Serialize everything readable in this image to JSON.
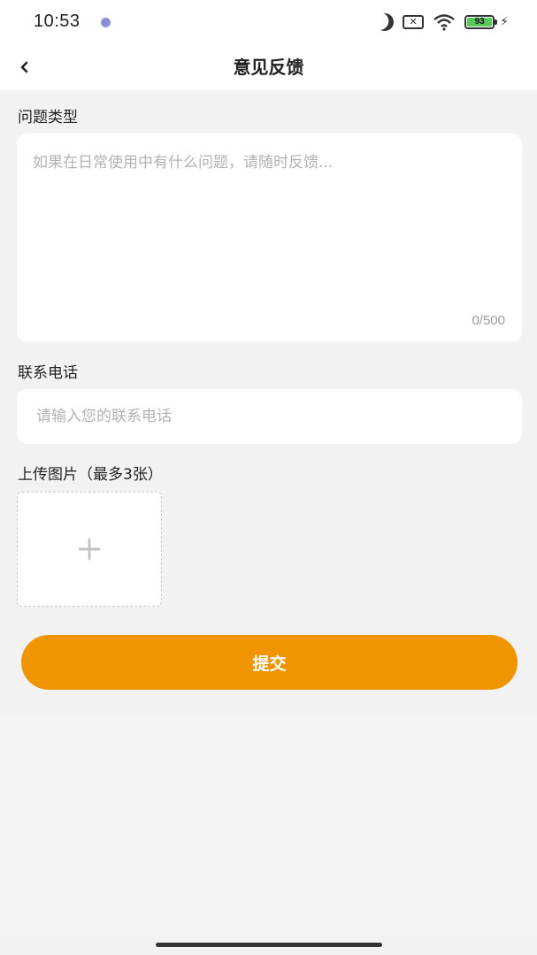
{
  "status_bar": {
    "time": "10:53",
    "battery": "93"
  },
  "nav": {
    "title": "意见反馈"
  },
  "form": {
    "issue_type_label": "问题类型",
    "issue_placeholder": "如果在日常使用中有什么问题，请随时反馈...",
    "char_count": "0/500",
    "phone_label": "联系电话",
    "phone_placeholder": "请输入您的联系电话",
    "upload_label": "上传图片（最多3张）",
    "submit_label": "提交"
  },
  "colors": {
    "accent": "#f09400",
    "background": "#f2f2f3",
    "card": "#ffffff"
  },
  "icons": {
    "back": "chevron-left-icon",
    "upload": "plus-icon"
  }
}
